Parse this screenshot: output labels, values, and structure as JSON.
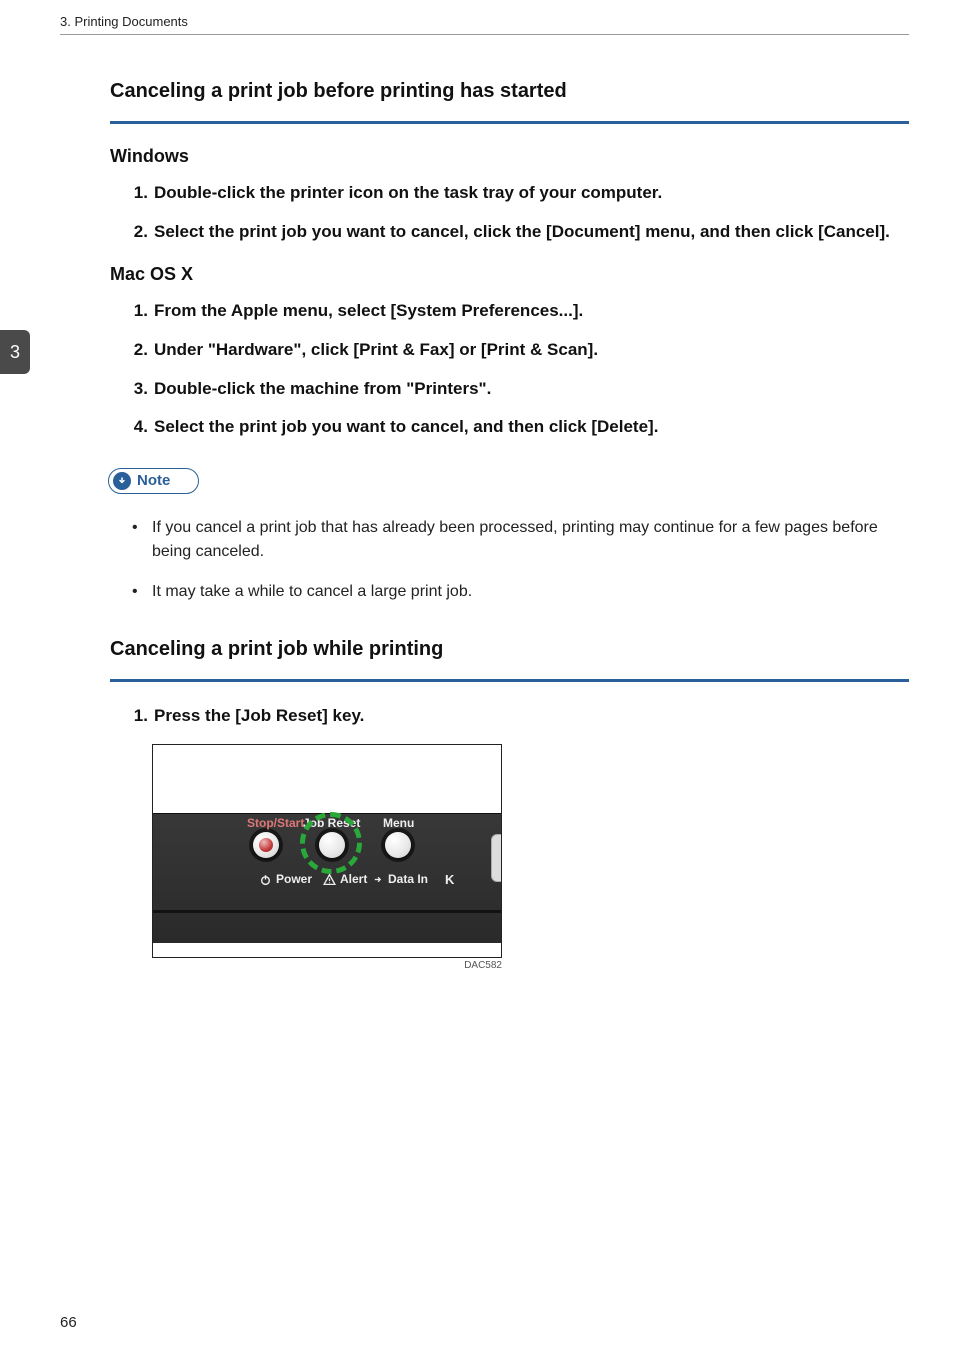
{
  "running_head": "3. Printing Documents",
  "chapter_tab": "3",
  "page_number": "66",
  "section1": {
    "title": "Canceling a print job before printing has started",
    "windows": {
      "heading": "Windows",
      "steps": [
        "Double-click the printer icon on the task tray of your computer.",
        "Select the print job you want to cancel, click the [Document] menu, and then click [Cancel]."
      ]
    },
    "macosx": {
      "heading": "Mac OS X",
      "steps": [
        "From the Apple menu, select [System Preferences...].",
        "Under \"Hardware\", click [Print & Fax] or [Print & Scan].",
        "Double-click the machine from \"Printers\".",
        "Select the print job you want to cancel, and then click [Delete]."
      ]
    },
    "note_label": "Note",
    "notes": [
      "If you cancel a print job that has already been processed, printing may continue for a few pages before being canceled.",
      "It may take a while to cancel a large print job."
    ]
  },
  "section2": {
    "title": "Canceling a print job while printing",
    "steps": [
      "Press the [Job Reset] key."
    ],
    "figure": {
      "caption": "DAC582",
      "labels": {
        "stop_start": "Stop/Start",
        "job_reset": "Job Reset",
        "menu": "Menu",
        "power": "Power",
        "alert": "Alert",
        "data_in": "Data In",
        "toner": "K"
      }
    }
  }
}
